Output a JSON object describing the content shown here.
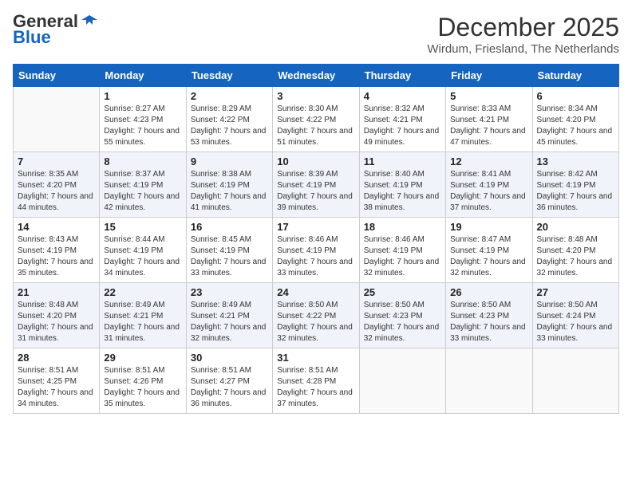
{
  "logo": {
    "general": "General",
    "blue": "Blue"
  },
  "header": {
    "title": "December 2025",
    "subtitle": "Wirdum, Friesland, The Netherlands"
  },
  "weekdays": [
    "Sunday",
    "Monday",
    "Tuesday",
    "Wednesday",
    "Thursday",
    "Friday",
    "Saturday"
  ],
  "weeks": [
    [
      {
        "day": "",
        "sunrise": "",
        "sunset": "",
        "daylight": ""
      },
      {
        "day": "1",
        "sunrise": "Sunrise: 8:27 AM",
        "sunset": "Sunset: 4:23 PM",
        "daylight": "Daylight: 7 hours and 55 minutes."
      },
      {
        "day": "2",
        "sunrise": "Sunrise: 8:29 AM",
        "sunset": "Sunset: 4:22 PM",
        "daylight": "Daylight: 7 hours and 53 minutes."
      },
      {
        "day": "3",
        "sunrise": "Sunrise: 8:30 AM",
        "sunset": "Sunset: 4:22 PM",
        "daylight": "Daylight: 7 hours and 51 minutes."
      },
      {
        "day": "4",
        "sunrise": "Sunrise: 8:32 AM",
        "sunset": "Sunset: 4:21 PM",
        "daylight": "Daylight: 7 hours and 49 minutes."
      },
      {
        "day": "5",
        "sunrise": "Sunrise: 8:33 AM",
        "sunset": "Sunset: 4:21 PM",
        "daylight": "Daylight: 7 hours and 47 minutes."
      },
      {
        "day": "6",
        "sunrise": "Sunrise: 8:34 AM",
        "sunset": "Sunset: 4:20 PM",
        "daylight": "Daylight: 7 hours and 45 minutes."
      }
    ],
    [
      {
        "day": "7",
        "sunrise": "Sunrise: 8:35 AM",
        "sunset": "Sunset: 4:20 PM",
        "daylight": "Daylight: 7 hours and 44 minutes."
      },
      {
        "day": "8",
        "sunrise": "Sunrise: 8:37 AM",
        "sunset": "Sunset: 4:19 PM",
        "daylight": "Daylight: 7 hours and 42 minutes."
      },
      {
        "day": "9",
        "sunrise": "Sunrise: 8:38 AM",
        "sunset": "Sunset: 4:19 PM",
        "daylight": "Daylight: 7 hours and 41 minutes."
      },
      {
        "day": "10",
        "sunrise": "Sunrise: 8:39 AM",
        "sunset": "Sunset: 4:19 PM",
        "daylight": "Daylight: 7 hours and 39 minutes."
      },
      {
        "day": "11",
        "sunrise": "Sunrise: 8:40 AM",
        "sunset": "Sunset: 4:19 PM",
        "daylight": "Daylight: 7 hours and 38 minutes."
      },
      {
        "day": "12",
        "sunrise": "Sunrise: 8:41 AM",
        "sunset": "Sunset: 4:19 PM",
        "daylight": "Daylight: 7 hours and 37 minutes."
      },
      {
        "day": "13",
        "sunrise": "Sunrise: 8:42 AM",
        "sunset": "Sunset: 4:19 PM",
        "daylight": "Daylight: 7 hours and 36 minutes."
      }
    ],
    [
      {
        "day": "14",
        "sunrise": "Sunrise: 8:43 AM",
        "sunset": "Sunset: 4:19 PM",
        "daylight": "Daylight: 7 hours and 35 minutes."
      },
      {
        "day": "15",
        "sunrise": "Sunrise: 8:44 AM",
        "sunset": "Sunset: 4:19 PM",
        "daylight": "Daylight: 7 hours and 34 minutes."
      },
      {
        "day": "16",
        "sunrise": "Sunrise: 8:45 AM",
        "sunset": "Sunset: 4:19 PM",
        "daylight": "Daylight: 7 hours and 33 minutes."
      },
      {
        "day": "17",
        "sunrise": "Sunrise: 8:46 AM",
        "sunset": "Sunset: 4:19 PM",
        "daylight": "Daylight: 7 hours and 33 minutes."
      },
      {
        "day": "18",
        "sunrise": "Sunrise: 8:46 AM",
        "sunset": "Sunset: 4:19 PM",
        "daylight": "Daylight: 7 hours and 32 minutes."
      },
      {
        "day": "19",
        "sunrise": "Sunrise: 8:47 AM",
        "sunset": "Sunset: 4:19 PM",
        "daylight": "Daylight: 7 hours and 32 minutes."
      },
      {
        "day": "20",
        "sunrise": "Sunrise: 8:48 AM",
        "sunset": "Sunset: 4:20 PM",
        "daylight": "Daylight: 7 hours and 32 minutes."
      }
    ],
    [
      {
        "day": "21",
        "sunrise": "Sunrise: 8:48 AM",
        "sunset": "Sunset: 4:20 PM",
        "daylight": "Daylight: 7 hours and 31 minutes."
      },
      {
        "day": "22",
        "sunrise": "Sunrise: 8:49 AM",
        "sunset": "Sunset: 4:21 PM",
        "daylight": "Daylight: 7 hours and 31 minutes."
      },
      {
        "day": "23",
        "sunrise": "Sunrise: 8:49 AM",
        "sunset": "Sunset: 4:21 PM",
        "daylight": "Daylight: 7 hours and 32 minutes."
      },
      {
        "day": "24",
        "sunrise": "Sunrise: 8:50 AM",
        "sunset": "Sunset: 4:22 PM",
        "daylight": "Daylight: 7 hours and 32 minutes."
      },
      {
        "day": "25",
        "sunrise": "Sunrise: 8:50 AM",
        "sunset": "Sunset: 4:23 PM",
        "daylight": "Daylight: 7 hours and 32 minutes."
      },
      {
        "day": "26",
        "sunrise": "Sunrise: 8:50 AM",
        "sunset": "Sunset: 4:23 PM",
        "daylight": "Daylight: 7 hours and 33 minutes."
      },
      {
        "day": "27",
        "sunrise": "Sunrise: 8:50 AM",
        "sunset": "Sunset: 4:24 PM",
        "daylight": "Daylight: 7 hours and 33 minutes."
      }
    ],
    [
      {
        "day": "28",
        "sunrise": "Sunrise: 8:51 AM",
        "sunset": "Sunset: 4:25 PM",
        "daylight": "Daylight: 7 hours and 34 minutes."
      },
      {
        "day": "29",
        "sunrise": "Sunrise: 8:51 AM",
        "sunset": "Sunset: 4:26 PM",
        "daylight": "Daylight: 7 hours and 35 minutes."
      },
      {
        "day": "30",
        "sunrise": "Sunrise: 8:51 AM",
        "sunset": "Sunset: 4:27 PM",
        "daylight": "Daylight: 7 hours and 36 minutes."
      },
      {
        "day": "31",
        "sunrise": "Sunrise: 8:51 AM",
        "sunset": "Sunset: 4:28 PM",
        "daylight": "Daylight: 7 hours and 37 minutes."
      },
      {
        "day": "",
        "sunrise": "",
        "sunset": "",
        "daylight": ""
      },
      {
        "day": "",
        "sunrise": "",
        "sunset": "",
        "daylight": ""
      },
      {
        "day": "",
        "sunrise": "",
        "sunset": "",
        "daylight": ""
      }
    ]
  ]
}
